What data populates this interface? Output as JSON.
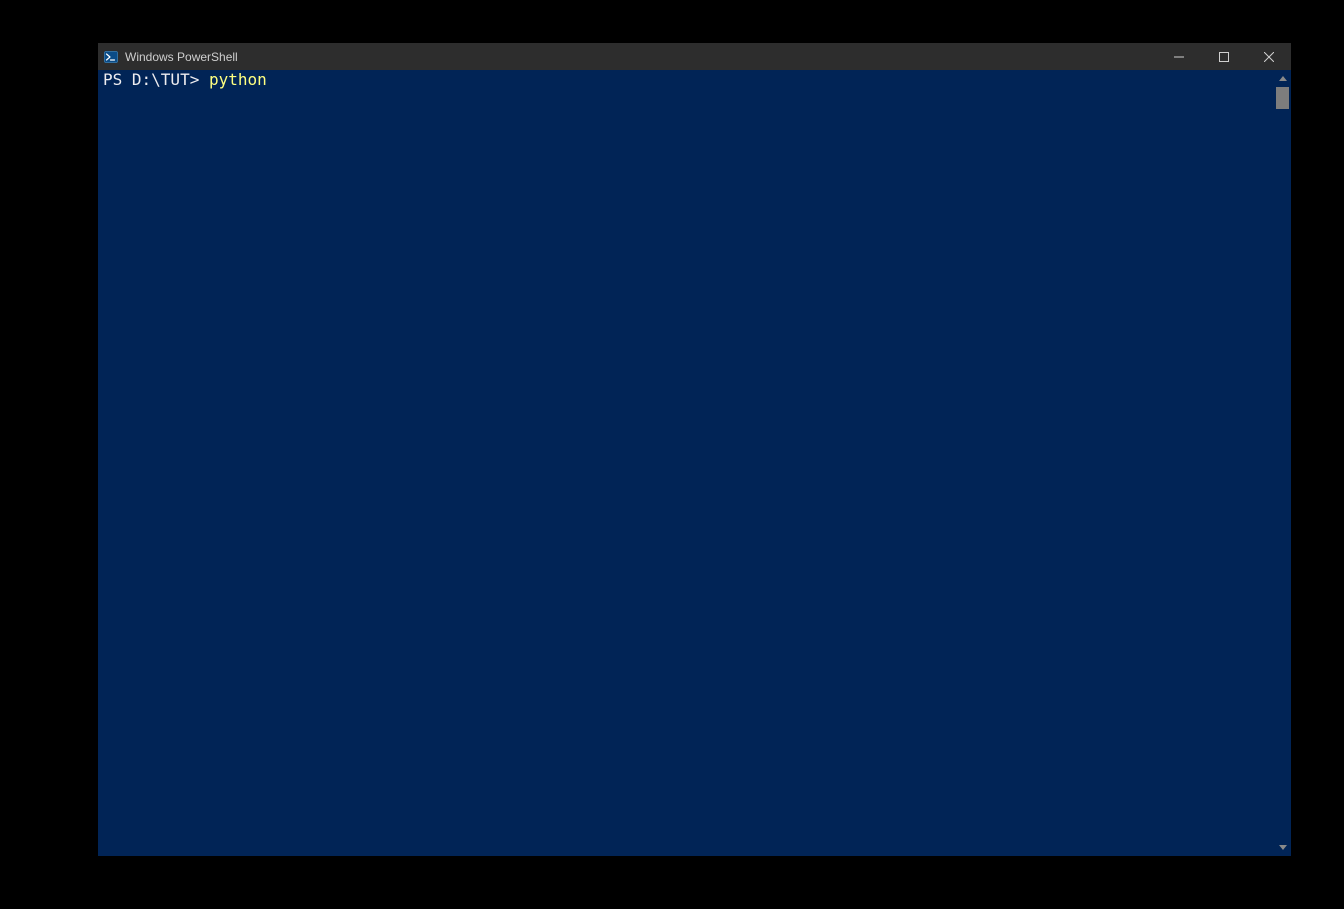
{
  "window": {
    "title": "Windows PowerShell"
  },
  "terminal": {
    "prompt": "PS D:\\TUT> ",
    "command": "python"
  }
}
